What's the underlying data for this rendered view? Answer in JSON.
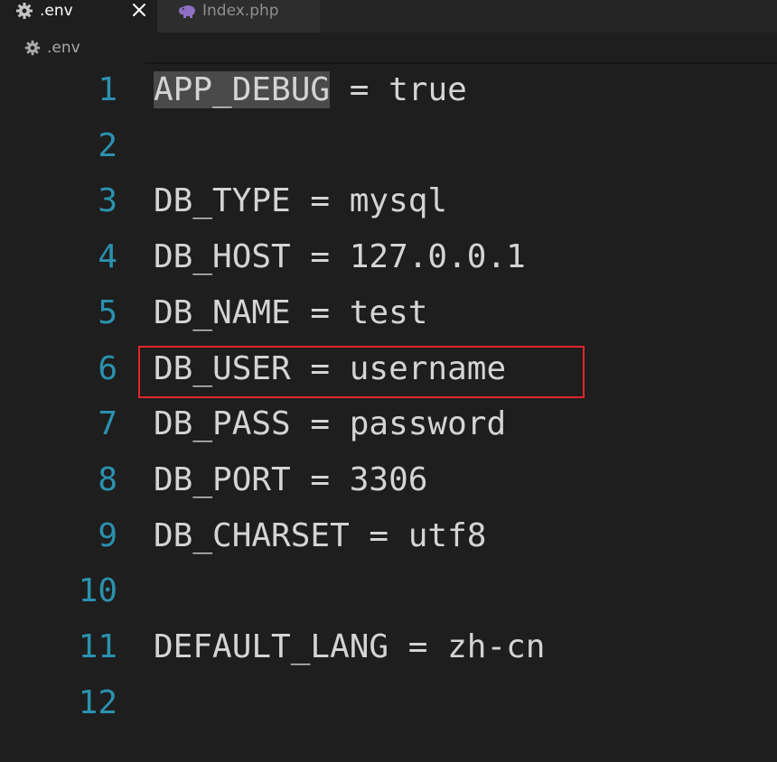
{
  "tabs": [
    {
      "label": ".env",
      "icon": "gear-icon",
      "active": true
    },
    {
      "label": "Index.php",
      "icon": "php-elephant-icon",
      "active": false
    }
  ],
  "close_icon": "close-icon",
  "breadcrumb": {
    "label": ".env",
    "icon": "gear-icon"
  },
  "editor": {
    "lines": [
      {
        "number": "1",
        "key": "APP_DEBUG",
        "rest": " = true"
      },
      {
        "number": "2",
        "text": ""
      },
      {
        "number": "3",
        "text": "DB_TYPE = mysql"
      },
      {
        "number": "4",
        "text": "DB_HOST = 127.0.0.1"
      },
      {
        "number": "5",
        "text": "DB_NAME = test"
      },
      {
        "number": "6",
        "text": "DB_USER = username"
      },
      {
        "number": "7",
        "text": "DB_PASS = password"
      },
      {
        "number": "8",
        "text": "DB_PORT = 3306"
      },
      {
        "number": "9",
        "text": "DB_CHARSET = utf8"
      },
      {
        "number": "10",
        "text": ""
      },
      {
        "number": "11",
        "text": "DEFAULT_LANG = zh-cn"
      },
      {
        "number": "12",
        "text": ""
      }
    ],
    "highlighted_line": "6"
  },
  "colors": {
    "line_number": "#2b91af",
    "code_text": "#d4d4d4",
    "background": "#1e1e1e",
    "highlight_border": "#e0262b"
  }
}
